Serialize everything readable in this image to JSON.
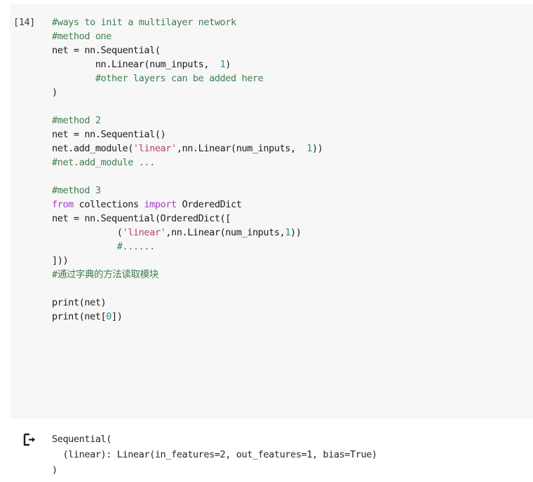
{
  "cell": {
    "execution_count_label": "[14]",
    "icons": {
      "output_icon": "output-arrow-icon"
    },
    "code_lines": [
      "#ways to init a multilayer network",
      "#method one",
      "net = nn.Sequential(",
      "        nn.Linear(num_inputs,  1)",
      "        #other layers can be added here",
      ")",
      "",
      "#method 2",
      "net = nn.Sequential()",
      "net.add_module('linear',nn.Linear(num_inputs,  1))",
      "#net.add_module ...",
      "",
      "#method 3",
      "from collections import OrderedDict",
      "net = nn.Sequential(OrderedDict([",
      "            ('linear',nn.Linear(num_inputs,1))",
      "            #......",
      "]))",
      "#通过字典的方法读取模块",
      "",
      "print(net)",
      "print(net[0])"
    ],
    "code_lines_tokens": [
      [
        {
          "t": "#ways to init a multilayer network",
          "c": "c"
        }
      ],
      [
        {
          "t": "#method one",
          "c": "c"
        }
      ],
      [
        {
          "t": "net = nn.Sequential(",
          "c": "p"
        }
      ],
      [
        {
          "t": "        nn.Linear(num_inputs,  ",
          "c": "p"
        },
        {
          "t": "1",
          "c": "n"
        },
        {
          "t": ")",
          "c": "p"
        }
      ],
      [
        {
          "t": "        #other layers can be added here",
          "c": "c"
        }
      ],
      [
        {
          "t": ")",
          "c": "p"
        }
      ],
      [
        {
          "t": "",
          "c": "p"
        }
      ],
      [
        {
          "t": "#method 2",
          "c": "c"
        }
      ],
      [
        {
          "t": "net = nn.Sequential()",
          "c": "p"
        }
      ],
      [
        {
          "t": "net.add_module(",
          "c": "p"
        },
        {
          "t": "'linear'",
          "c": "s"
        },
        {
          "t": ",nn.Linear(num_inputs,  ",
          "c": "p"
        },
        {
          "t": "1",
          "c": "n"
        },
        {
          "t": "))",
          "c": "p"
        }
      ],
      [
        {
          "t": "#net.add_module ...",
          "c": "c"
        }
      ],
      [
        {
          "t": "",
          "c": "p"
        }
      ],
      [
        {
          "t": "#method 3",
          "c": "c"
        }
      ],
      [
        {
          "t": "from",
          "c": "k"
        },
        {
          "t": " collections ",
          "c": "p"
        },
        {
          "t": "import",
          "c": "k"
        },
        {
          "t": " OrderedDict",
          "c": "p"
        }
      ],
      [
        {
          "t": "net = nn.Sequential(OrderedDict([",
          "c": "p"
        }
      ],
      [
        {
          "t": "            (",
          "c": "p"
        },
        {
          "t": "'linear'",
          "c": "s"
        },
        {
          "t": ",nn.Linear(num_inputs,",
          "c": "p"
        },
        {
          "t": "1",
          "c": "n"
        },
        {
          "t": "))",
          "c": "p"
        }
      ],
      [
        {
          "t": "            #......",
          "c": "c"
        }
      ],
      [
        {
          "t": "]))",
          "c": "p"
        }
      ],
      [
        {
          "t": "#通过字典的方法读取模块",
          "c": "c"
        }
      ],
      [
        {
          "t": "",
          "c": "p"
        }
      ],
      [
        {
          "t": "print(net)",
          "c": "p"
        }
      ],
      [
        {
          "t": "print(net[",
          "c": "p"
        },
        {
          "t": "0",
          "c": "n"
        },
        {
          "t": "])",
          "c": "p"
        }
      ]
    ],
    "output_lines": [
      "Sequential(",
      "  (linear): Linear(in_features=2, out_features=1, bias=True)",
      ")"
    ]
  },
  "colors": {
    "cell_background": "#f7f7f7",
    "page_background": "#ffffff",
    "comment": "#3f7d4f",
    "keyword": "#a33fc6",
    "string": "#b5445a",
    "number": "#2a9090",
    "plain_text": "#1b1b1b",
    "output_text": "#262626",
    "execution_count": "#3c3c3c"
  }
}
